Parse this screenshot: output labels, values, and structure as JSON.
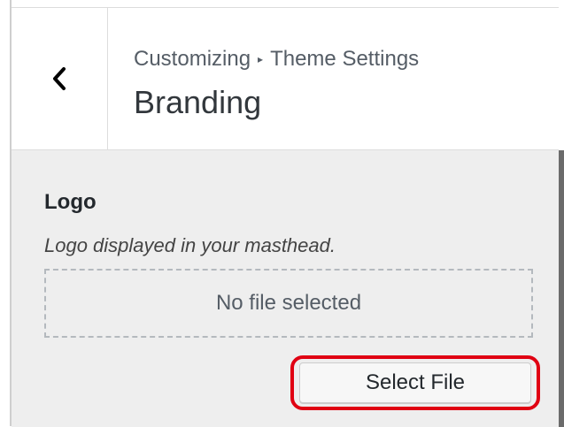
{
  "header": {
    "breadcrumb": {
      "parent": "Customizing",
      "separator": "▸",
      "current": "Theme Settings"
    },
    "title": "Branding",
    "back_icon": "chevron-left-icon"
  },
  "section": {
    "label": "Logo",
    "description": "Logo displayed in your masthead.",
    "dropzone_text": "No file selected",
    "select_button_label": "Select File"
  },
  "colors": {
    "highlight": "#e00012",
    "panel_background": "#eeeeee"
  }
}
